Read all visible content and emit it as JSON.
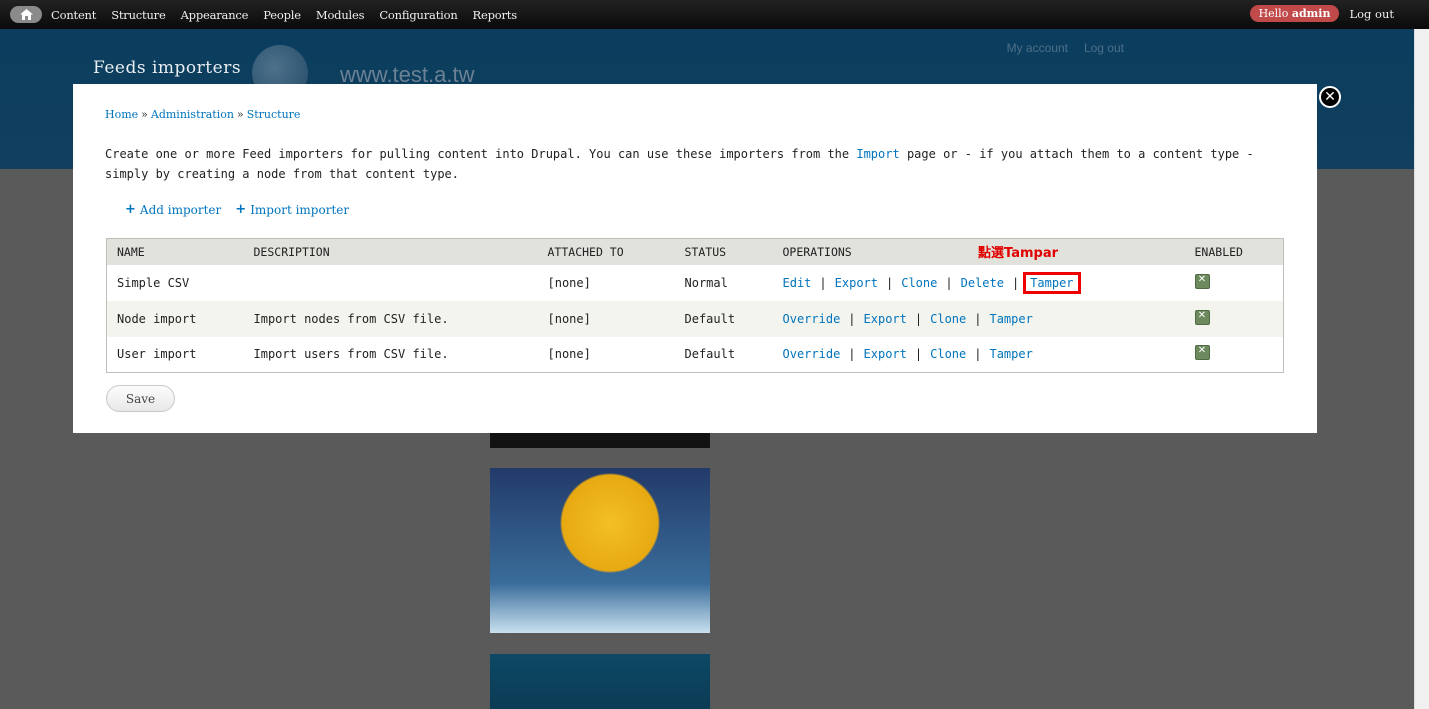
{
  "toolbar": {
    "home_icon": "home-icon",
    "menu": [
      "Content",
      "Structure",
      "Appearance",
      "People",
      "Modules",
      "Configuration",
      "Reports"
    ],
    "hello_prefix": "Hello ",
    "username": "admin",
    "logout": "Log out"
  },
  "site": {
    "name": "Feeds importers",
    "watermark": "www.test.a.tw",
    "secondary_links": [
      "My account",
      "Log out"
    ]
  },
  "breadcrumb": [
    "Home",
    "Administration",
    "Structure"
  ],
  "intro": {
    "before_link": "Create one or more Feed importers for pulling content into Drupal. You can use these importers from the ",
    "link": "Import",
    "after_link": " page or - if you attach them to a content type - simply by creating a node from that content type."
  },
  "actions": {
    "add_importer": "Add importer",
    "import_importer": "Import importer"
  },
  "table": {
    "headers": [
      "NAME",
      "DESCRIPTION",
      "ATTACHED TO",
      "STATUS",
      "OPERATIONS",
      "ENABLED"
    ],
    "rows": [
      {
        "name": "Simple CSV",
        "description": "",
        "attached_to": "[none]",
        "status": "Normal",
        "operations": [
          "Edit",
          "Export",
          "Clone",
          "Delete",
          "Tamper"
        ],
        "enabled": true
      },
      {
        "name": "Node import",
        "description": "Import nodes from CSV file.",
        "attached_to": "[none]",
        "status": "Default",
        "operations": [
          "Override",
          "Export",
          "Clone",
          "Tamper"
        ],
        "enabled": true
      },
      {
        "name": "User import",
        "description": "Import users from CSV file.",
        "attached_to": "[none]",
        "status": "Default",
        "operations": [
          "Override",
          "Export",
          "Clone",
          "Tamper"
        ],
        "enabled": true
      }
    ]
  },
  "annotation": "點選Tampar",
  "save_label": "Save",
  "colors": {
    "link": "#0074bd",
    "annotation": "#e10000",
    "hello_badge": "#c0494a"
  }
}
